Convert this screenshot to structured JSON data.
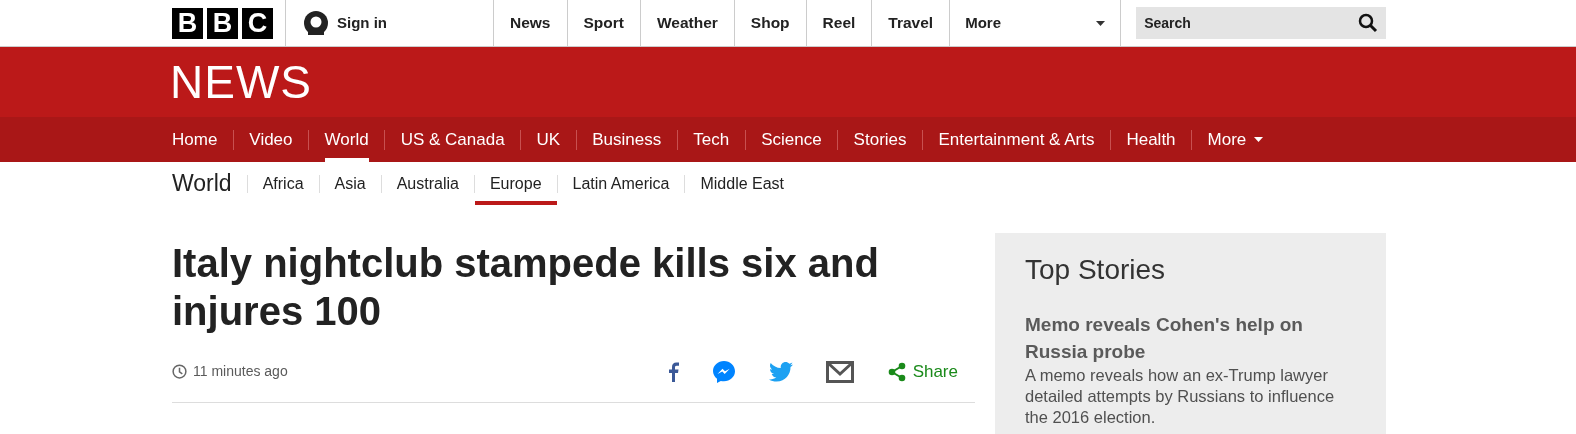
{
  "masthead": {
    "logo_letters": [
      "B",
      "B",
      "C"
    ],
    "sign_in": "Sign in",
    "nav": [
      {
        "label": "News",
        "kind": "link"
      },
      {
        "label": "Sport",
        "kind": "link"
      },
      {
        "label": "Weather",
        "kind": "link"
      },
      {
        "label": "Shop",
        "kind": "link"
      },
      {
        "label": "Reel",
        "kind": "link"
      },
      {
        "label": "Travel",
        "kind": "link"
      },
      {
        "label": "More",
        "kind": "dropdown"
      }
    ],
    "search": {
      "placeholder": "Search"
    }
  },
  "news_banner": {
    "title": "NEWS"
  },
  "section_nav": [
    {
      "label": "Home",
      "selected": false,
      "kind": "link"
    },
    {
      "label": "Video",
      "selected": false,
      "kind": "link"
    },
    {
      "label": "World",
      "selected": true,
      "kind": "link"
    },
    {
      "label": "US & Canada",
      "selected": false,
      "kind": "link"
    },
    {
      "label": "UK",
      "selected": false,
      "kind": "link"
    },
    {
      "label": "Business",
      "selected": false,
      "kind": "link"
    },
    {
      "label": "Tech",
      "selected": false,
      "kind": "link"
    },
    {
      "label": "Science",
      "selected": false,
      "kind": "link"
    },
    {
      "label": "Stories",
      "selected": false,
      "kind": "link"
    },
    {
      "label": "Entertainment & Arts",
      "selected": false,
      "kind": "link"
    },
    {
      "label": "Health",
      "selected": false,
      "kind": "link"
    },
    {
      "label": "More",
      "selected": false,
      "kind": "dropdown"
    }
  ],
  "sub_nav": {
    "title": "World",
    "items": [
      {
        "label": "Africa",
        "selected": false
      },
      {
        "label": "Asia",
        "selected": false
      },
      {
        "label": "Australia",
        "selected": false
      },
      {
        "label": "Europe",
        "selected": true
      },
      {
        "label": "Latin America",
        "selected": false
      },
      {
        "label": "Middle East",
        "selected": false
      }
    ]
  },
  "article": {
    "headline": "Italy nightclub stampede kills six and injures 100",
    "timestamp": "11 minutes ago",
    "share": [
      {
        "kind": "facebook"
      },
      {
        "kind": "messenger"
      },
      {
        "kind": "twitter"
      },
      {
        "kind": "email"
      },
      {
        "kind": "share",
        "label": "Share"
      }
    ]
  },
  "top_stories": {
    "title": "Top Stories",
    "items": [
      {
        "headline": "Memo reveals Cohen's help on Russia probe",
        "summary": "A memo reveals how an ex-Trump lawyer detailed attempts by Russians to influence the 2016 election."
      }
    ]
  }
}
